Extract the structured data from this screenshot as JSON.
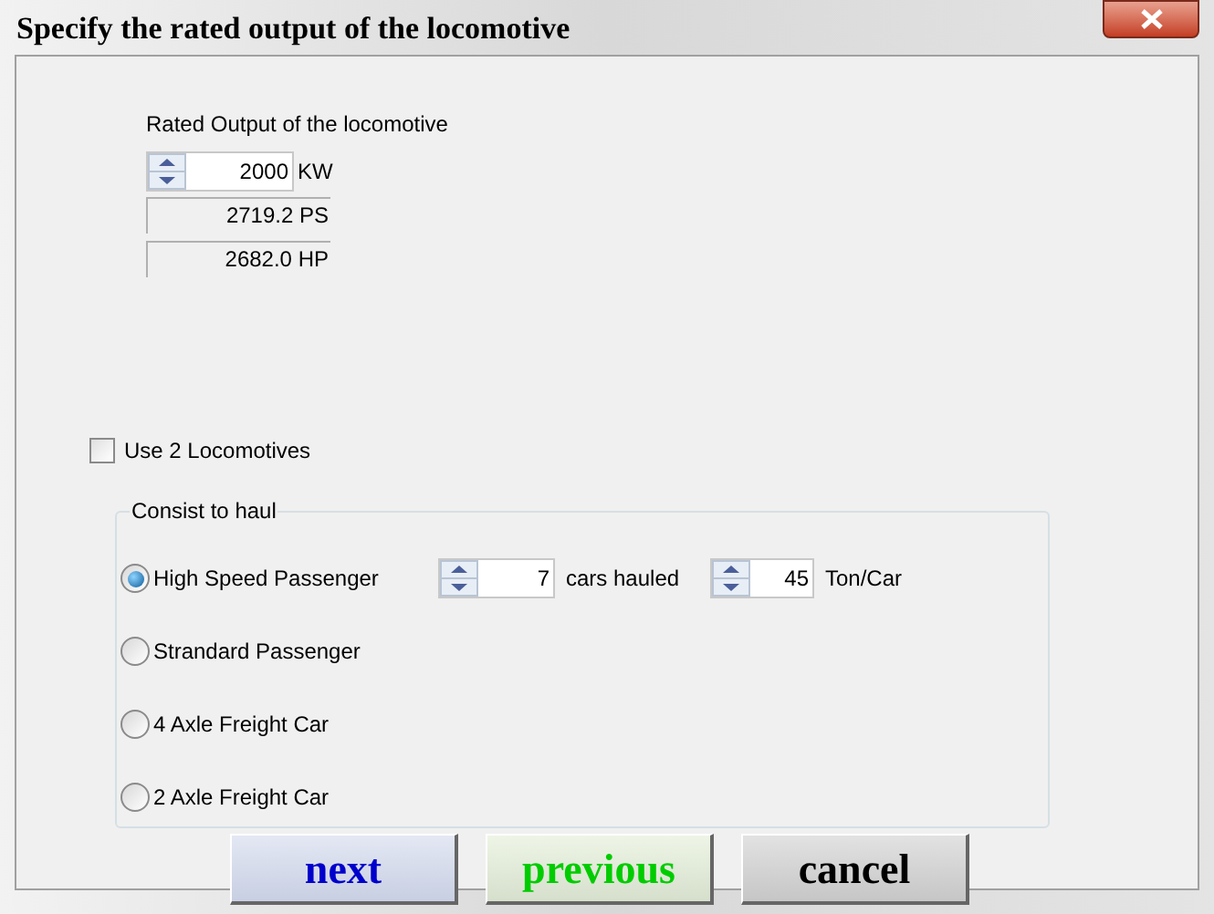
{
  "window": {
    "title": "Specify the rated output of the locomotive"
  },
  "output": {
    "label": "Rated Output of the locomotive",
    "value": "2000",
    "unit": "KW",
    "conversions": [
      {
        "value": "2719.2 PS"
      },
      {
        "value": "2682.0 HP"
      }
    ]
  },
  "use_two_locomotives": {
    "label": "Use 2 Locomotives",
    "checked": false
  },
  "consist": {
    "title": "Consist to haul",
    "options": [
      {
        "label": "High Speed Passenger",
        "selected": true
      },
      {
        "label": "Strandard Passenger",
        "selected": false
      },
      {
        "label": "4 Axle Freight Car",
        "selected": false
      },
      {
        "label": "2 Axle Freight Car",
        "selected": false
      }
    ],
    "cars": {
      "value": "7",
      "unit": "cars hauled"
    },
    "weight": {
      "value": "45",
      "unit": "Ton/Car"
    }
  },
  "buttons": [
    {
      "label": "next",
      "color": "#0000cc"
    },
    {
      "label": "previous",
      "color": "#00cc00"
    },
    {
      "label": "cancel",
      "color": "#000000"
    }
  ]
}
